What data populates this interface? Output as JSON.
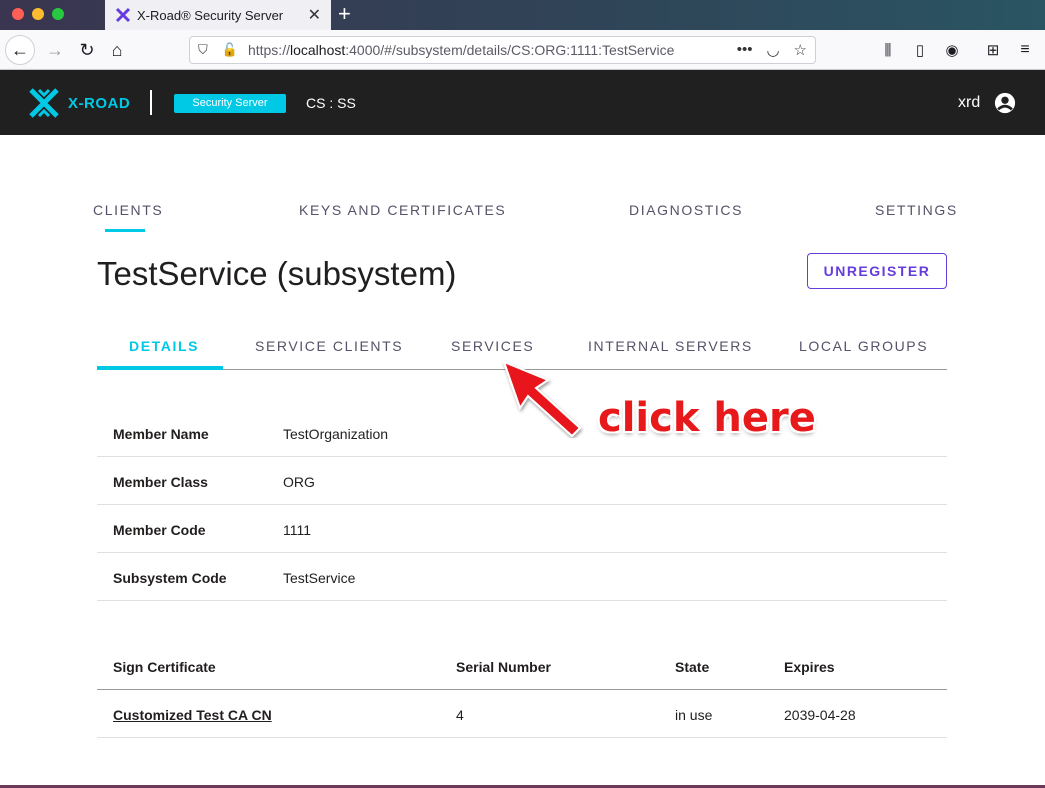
{
  "browser": {
    "tab_title": "X-Road® Security Server",
    "new_tab_label": "+",
    "url_prefix": "https://",
    "url_host": "localhost",
    "url_rest": ":4000/#/subsystem/details/CS:ORG:1111:TestService"
  },
  "header": {
    "logo_text": "X-ROAD",
    "badge": "Security Server",
    "instance": "CS : SS",
    "user": "xrd"
  },
  "main_nav": {
    "clients": "CLIENTS",
    "keys": "KEYS AND CERTIFICATES",
    "diagnostics": "DIAGNOSTICS",
    "settings": "SETTINGS"
  },
  "page": {
    "title": "TestService (subsystem)",
    "unregister_label": "UNREGISTER"
  },
  "subtabs": {
    "details": "DETAILS",
    "service_clients": "SERVICE CLIENTS",
    "services": "SERVICES",
    "internal_servers": "INTERNAL SERVERS",
    "local_groups": "LOCAL GROUPS"
  },
  "details": [
    {
      "label": "Member Name",
      "value": "TestOrganization"
    },
    {
      "label": "Member Class",
      "value": "ORG"
    },
    {
      "label": "Member Code",
      "value": "1111"
    },
    {
      "label": "Subsystem Code",
      "value": "TestService"
    }
  ],
  "certificates": {
    "headers": [
      "Sign Certificate",
      "Serial Number",
      "State",
      "Expires"
    ],
    "rows": [
      {
        "name": "Customized Test CA CN",
        "serial": "4",
        "state": "in use",
        "expires": "2039-04-28"
      }
    ]
  },
  "annotation": {
    "text": "click here",
    "color": "#e8191b"
  },
  "colors": {
    "accent": "#00c9e6",
    "purple": "#663cdc",
    "header_bg": "#202020"
  }
}
